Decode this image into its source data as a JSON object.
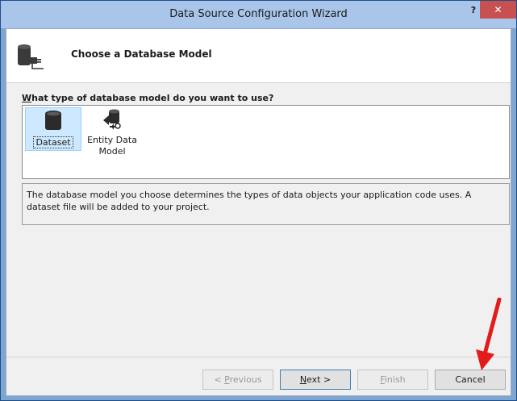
{
  "window": {
    "title": "Data Source Configuration Wizard",
    "help_label": "?",
    "close_label": "✕"
  },
  "header": {
    "title": "Choose a Database Model",
    "icon": "database-connector-icon"
  },
  "main": {
    "question_prefix": "W",
    "question_rest": "hat type of database model do you want to use?",
    "models": [
      {
        "label": "Dataset",
        "icon": "database-icon",
        "selected": true
      },
      {
        "label_line1": "Entity Data",
        "label_line2": "Model",
        "icon": "entity-model-icon",
        "selected": false
      }
    ],
    "description": "The database model you choose determines the types of data objects your application code uses. A dataset file will be added to your project."
  },
  "buttons": {
    "previous": {
      "pre": "< ",
      "mnemonic": "P",
      "rest": "revious",
      "enabled": false
    },
    "next": {
      "mnemonic": "N",
      "rest": "ext >",
      "enabled": true
    },
    "finish": {
      "mnemonic": "F",
      "rest": "inish",
      "enabled": false
    },
    "cancel": {
      "label": "Cancel",
      "enabled": true
    }
  },
  "annotation": {
    "arrow_color": "#e31b1b",
    "icon": "red-arrow-icon"
  },
  "colors": {
    "titlebar": "#a9c5ea",
    "close_button": "#c75050",
    "selection": "#cde8ff"
  }
}
